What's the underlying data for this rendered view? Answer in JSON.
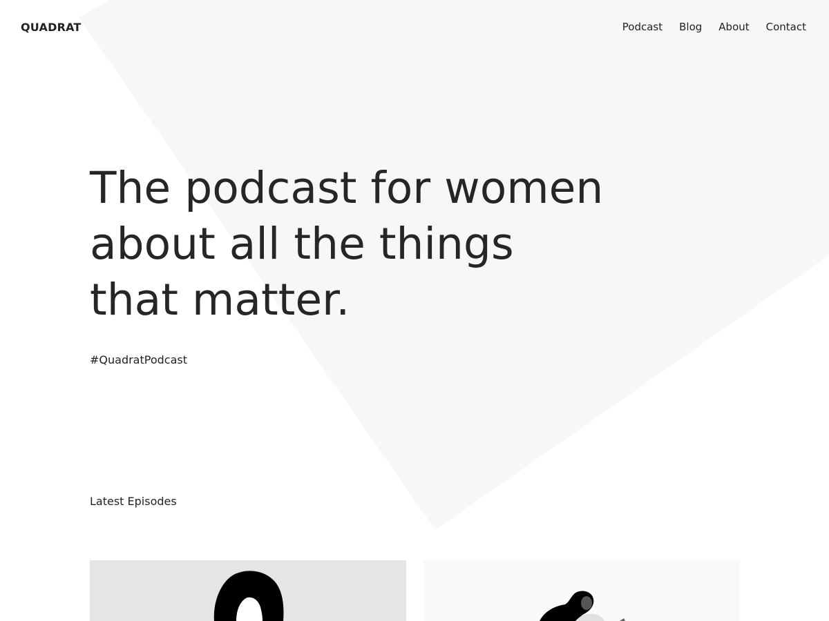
{
  "site": {
    "title": "QUADRAT"
  },
  "nav": {
    "items": [
      "Podcast",
      "Blog",
      "About",
      "Contact"
    ]
  },
  "hero": {
    "title_lines": [
      "The podcast for women",
      "about all the things",
      "that matter."
    ],
    "hashtag": "#QuadratPodcast"
  },
  "episodes": {
    "heading": "Latest Episodes"
  },
  "colors": {
    "background": "#ffffff",
    "shape": "#f7f7f7",
    "text": "#222222",
    "card_one_bg": "#e5e5e5",
    "card_two_bg": "#f9f9f9"
  }
}
